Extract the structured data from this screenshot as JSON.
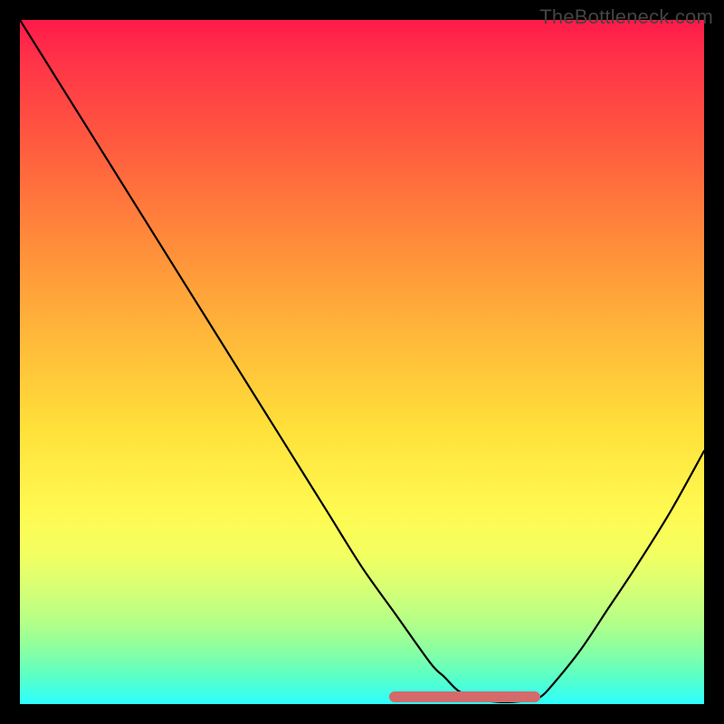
{
  "watermark": "TheBottleneck.com",
  "colors": {
    "curve_stroke": "#000000",
    "pink_segment": "#d46a6a",
    "gradient_top": "#ff1a4a",
    "gradient_bottom": "#2dffff"
  },
  "chart_data": {
    "type": "line",
    "title": "",
    "xlabel": "",
    "ylabel": "",
    "xlim": [
      0,
      100
    ],
    "ylim": [
      0,
      100
    ],
    "series": [
      {
        "name": "bottleneck-curve",
        "x": [
          0,
          5,
          10,
          15,
          20,
          25,
          30,
          35,
          40,
          45,
          50,
          55,
          60,
          62,
          64,
          66,
          68,
          70,
          72,
          74,
          76,
          78,
          82,
          86,
          90,
          95,
          100
        ],
        "y": [
          100,
          92,
          84,
          76,
          68,
          60,
          52,
          44,
          36,
          28,
          20,
          13,
          6,
          4,
          2,
          1,
          0.5,
          0.3,
          0.3,
          0.5,
          1,
          3,
          8,
          14,
          20,
          28,
          37
        ]
      }
    ],
    "annotations": [
      {
        "type": "segment",
        "name": "optimal-range-marker",
        "x_start": 54,
        "x_end": 76,
        "y": 0.3,
        "color": "#d46a6a"
      }
    ],
    "grid": false,
    "legend": false
  }
}
